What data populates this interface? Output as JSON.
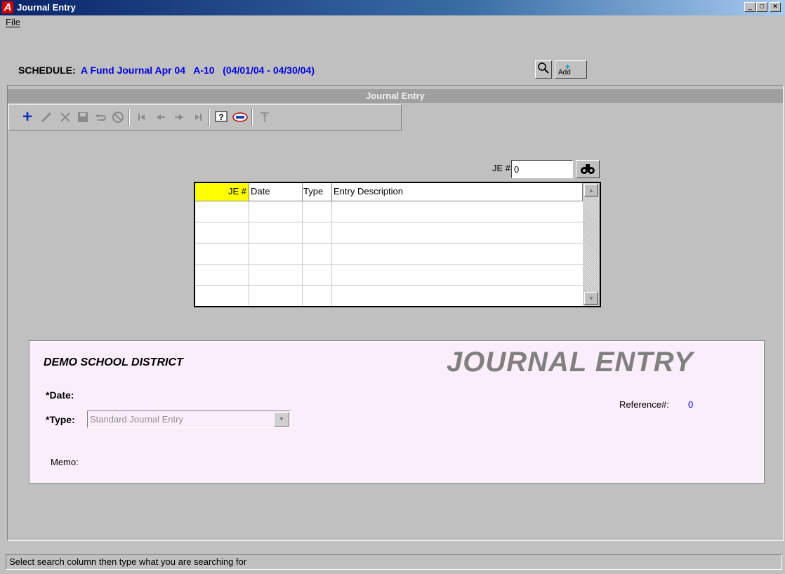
{
  "window": {
    "title": "Journal Entry",
    "app_logo": "A",
    "minimize": "_",
    "maximize": "□",
    "close": "×"
  },
  "menu": {
    "file": "File"
  },
  "schedule": {
    "label": "SCHEDULE:",
    "value": "A Fund Journal Apr 04   A-10   (04/01/04 - 04/30/04)",
    "add_label": "Add"
  },
  "panel": {
    "title": "Journal Entry"
  },
  "toolbar": {
    "icons": [
      "add-icon",
      "edit-icon",
      "delete-icon",
      "save-icon",
      "undo-icon",
      "cancel-icon",
      "first-record-icon",
      "previous-record-icon",
      "next-record-icon",
      "last-record-icon",
      "help-icon",
      "reports-icon",
      "filter-icon"
    ]
  },
  "search": {
    "label": "JE #:",
    "value": "0"
  },
  "grid": {
    "columns": [
      "JE #",
      "Date",
      "Type",
      "Entry Description"
    ],
    "rows": [
      [
        "",
        "",
        "",
        ""
      ],
      [
        "",
        "",
        "",
        ""
      ],
      [
        "",
        "",
        "",
        ""
      ],
      [
        "",
        "",
        "",
        ""
      ],
      [
        "",
        "",
        "",
        ""
      ]
    ]
  },
  "form": {
    "organization": "DEMO SCHOOL DISTRICT",
    "heading": "JOURNAL ENTRY",
    "date_label": "*Date:",
    "type_label": "*Type:",
    "type_value": "Standard Journal Entry",
    "reference_label": "Reference#:",
    "reference_value": "0",
    "memo_label": "Memo:"
  },
  "status": {
    "text": "Select search column then type what you are searching for"
  },
  "colors": {
    "title_bar": "#0a246a",
    "accent_text": "#0000e0",
    "highlight_cell": "#ffff00",
    "form_bg": "#fbeefb"
  }
}
